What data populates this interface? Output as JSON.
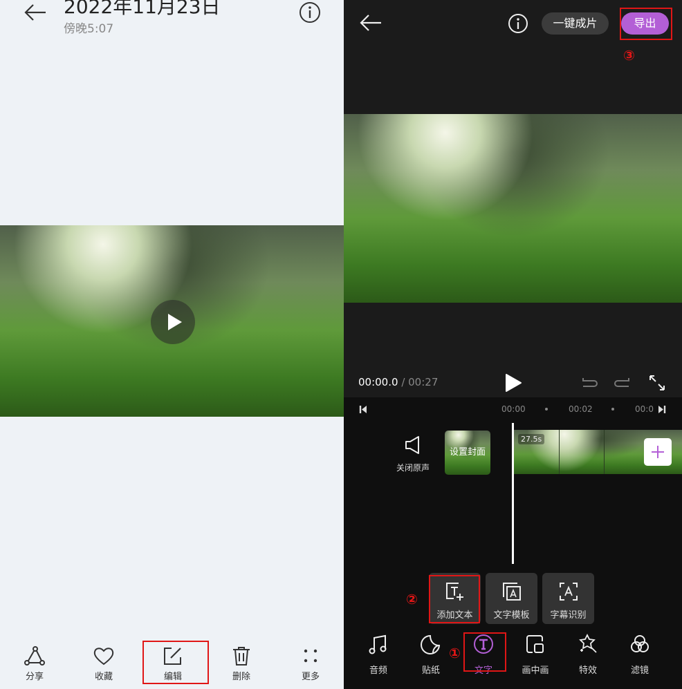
{
  "left": {
    "title": "2022年11月23日",
    "subtitle": "傍晚5:07",
    "toolbar": [
      {
        "label": "分享",
        "icon": "share-icon"
      },
      {
        "label": "收藏",
        "icon": "heart-icon"
      },
      {
        "label": "编辑",
        "icon": "edit-icon"
      },
      {
        "label": "删除",
        "icon": "trash-icon"
      },
      {
        "label": "更多",
        "icon": "more-icon"
      }
    ]
  },
  "right": {
    "one_click_label": "一键成片",
    "export_label": "导出",
    "current_time": "00:00.0",
    "separator": " / ",
    "total_time": "00:27",
    "ruler": [
      "00:00",
      "00:02",
      "00:0"
    ],
    "mute_label": "关闭原声",
    "cover_label": "设置封面",
    "clip_duration": "27.5s",
    "text_tools": [
      {
        "label": "添加文本",
        "icon": "add-text-icon"
      },
      {
        "label": "文字模板",
        "icon": "text-template-icon"
      },
      {
        "label": "字幕识别",
        "icon": "subtitle-recognition-icon"
      }
    ],
    "nav": [
      {
        "label": "音频",
        "icon": "music-icon"
      },
      {
        "label": "贴纸",
        "icon": "sticker-icon"
      },
      {
        "label": "文字",
        "icon": "text-icon",
        "active": true
      },
      {
        "label": "画中画",
        "icon": "pip-icon"
      },
      {
        "label": "特效",
        "icon": "effects-icon"
      },
      {
        "label": "滤镜",
        "icon": "filter-icon"
      }
    ],
    "accent_color": "#b35fd6"
  },
  "annotations": [
    "①",
    "②",
    "③"
  ],
  "annotation_color": "#e01616"
}
